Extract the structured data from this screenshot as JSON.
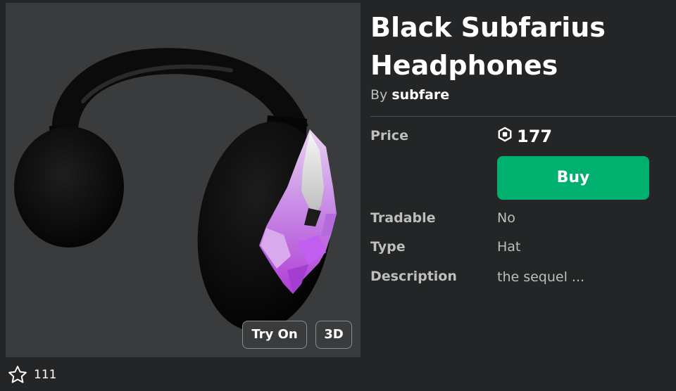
{
  "item": {
    "title": "Black Subfarius Headphones",
    "by_label": "By",
    "creator": "subfare"
  },
  "thumbnail": {
    "try_on_label": "Try On",
    "view_3d_label": "3D"
  },
  "favorites": {
    "count": "111",
    "icon": "star-outline-icon"
  },
  "details": {
    "price_label": "Price",
    "price_value": "177",
    "currency_icon": "robux-icon",
    "buy_label": "Buy",
    "tradable_label": "Tradable",
    "tradable_value": "No",
    "type_label": "Type",
    "type_value": "Hat",
    "description_label": "Description",
    "description_value": "the sequel ..."
  },
  "colors": {
    "background": "#232527",
    "panel": "#393b3d",
    "buy_button": "#00b06f",
    "muted_text": "#bdbebe"
  }
}
